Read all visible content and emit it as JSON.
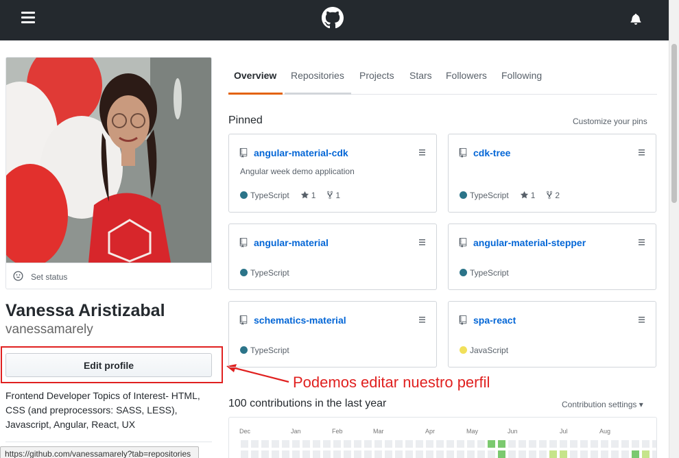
{
  "header": {
    "menu_icon": "hamburger-icon",
    "logo_icon": "github-octocat-icon",
    "notification_icon": "bell-icon",
    "background": "#24292e"
  },
  "profile": {
    "set_status_label": "Set status",
    "full_name": "Vanessa Aristizabal",
    "username": "vanessamarely",
    "edit_button_label": "Edit profile",
    "bio": "Frontend Developer Topics of Interest- HTML, CSS (and preprocessors: SASS, LESS), Javascript, Angular, React, UX"
  },
  "annotation": {
    "text": "Podemos editar nuestro perfil",
    "color": "#e0201f"
  },
  "status_bar": {
    "url": "https://github.com/vanessamarely?tab=repositories"
  },
  "tabs": [
    {
      "label": "Overview",
      "active": true
    },
    {
      "label": "Repositories",
      "active": false
    },
    {
      "label": "Projects",
      "active": false
    },
    {
      "label": "Stars",
      "active": false
    },
    {
      "label": "Followers",
      "active": false
    },
    {
      "label": "Following",
      "active": false
    }
  ],
  "pinned": {
    "title": "Pinned",
    "customize_label": "Customize your pins",
    "repos": [
      {
        "name": "angular-material-cdk",
        "description": "Angular week demo application",
        "language": "TypeScript",
        "lang_color": "#2b7489",
        "stars": "1",
        "forks": "1"
      },
      {
        "name": "cdk-tree",
        "description": "",
        "language": "TypeScript",
        "lang_color": "#2b7489",
        "stars": "1",
        "forks": "2"
      },
      {
        "name": "angular-material",
        "description": "",
        "language": "TypeScript",
        "lang_color": "#2b7489",
        "stars": "",
        "forks": ""
      },
      {
        "name": "angular-material-stepper",
        "description": "",
        "language": "TypeScript",
        "lang_color": "#2b7489",
        "stars": "",
        "forks": ""
      },
      {
        "name": "schematics-material",
        "description": "",
        "language": "TypeScript",
        "lang_color": "#2b7489",
        "stars": "",
        "forks": ""
      },
      {
        "name": "spa-react",
        "description": "",
        "language": "JavaScript",
        "lang_color": "#f1e05a",
        "stars": "",
        "forks": ""
      }
    ]
  },
  "contributions": {
    "title": "100 contributions in the last year",
    "settings_label": "Contribution settings ▾",
    "months": [
      "Dec",
      "Jan",
      "Feb",
      "Mar",
      "Apr",
      "May",
      "Jun",
      "Jul",
      "Aug"
    ],
    "colors": {
      "empty": "#ebedf0",
      "light": "#c6e48b",
      "medium": "#7bc96f"
    },
    "weeks_row0": [
      0,
      0,
      0,
      0,
      0,
      0,
      0,
      0,
      0,
      0,
      0,
      0,
      0,
      0,
      0,
      0,
      0,
      0,
      0,
      0,
      0,
      0,
      0,
      0,
      2,
      2,
      0,
      0,
      0,
      0,
      0,
      0,
      0,
      0,
      0,
      0,
      0,
      0,
      0,
      0,
      0
    ],
    "weeks_row1": [
      0,
      0,
      0,
      0,
      0,
      0,
      0,
      0,
      0,
      0,
      0,
      0,
      0,
      0,
      0,
      0,
      0,
      0,
      0,
      0,
      0,
      0,
      0,
      0,
      0,
      2,
      0,
      0,
      0,
      0,
      1,
      1,
      0,
      0,
      0,
      0,
      0,
      0,
      2,
      1,
      0
    ]
  }
}
